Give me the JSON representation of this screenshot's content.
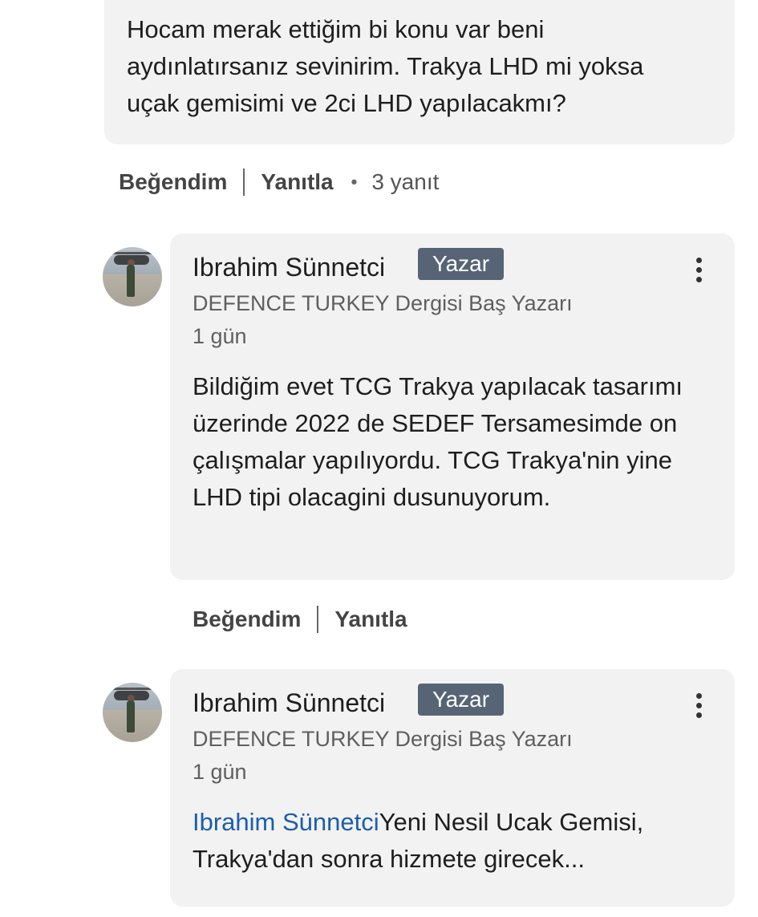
{
  "top_comment": {
    "text": "Hocam merak ettiğim bi konu var beni\naydınlatırsanız sevinirim. Trakya LHD mi yoksa\nuçak gemisimi ve 2ci LHD yapılacakmı?",
    "like_label": "Beğendim",
    "reply_label": "Yanıtla",
    "reply_count": "3 yanıt"
  },
  "replies": [
    {
      "author": "Ibrahim Sünnetci",
      "badge": "Yazar",
      "subtitle": "DEFENCE TURKEY Dergisi Baş Yazarı",
      "time": "1 gün",
      "text": "Bildiğim evet TCG Trakya yapılacak tasarımı üzerinde 2022 de SEDEF Tersamesimde on çalışmalar yapılıyordu. TCG Trakya'nin yine LHD tipi olacagini dusunuyorum.",
      "like_label": "Beğendim",
      "reply_label": "Yanıtla"
    },
    {
      "author": "Ibrahim Sünnetci",
      "badge": "Yazar",
      "subtitle": "DEFENCE TURKEY Dergisi Baş Yazarı",
      "time": "1 gün",
      "mention": "Ibrahim Sünnetci",
      "text": "Yeni Nesil Ucak Gemisi, Trakya'dan sonra hizmete girecek..."
    }
  ],
  "icons": {
    "more": "vertical-ellipsis-icon",
    "avatar": "user-avatar-photo"
  },
  "colors": {
    "badge_bg": "#566476",
    "bubble_bg": "#f2f2f2",
    "mention": "#1d5ea8"
  }
}
